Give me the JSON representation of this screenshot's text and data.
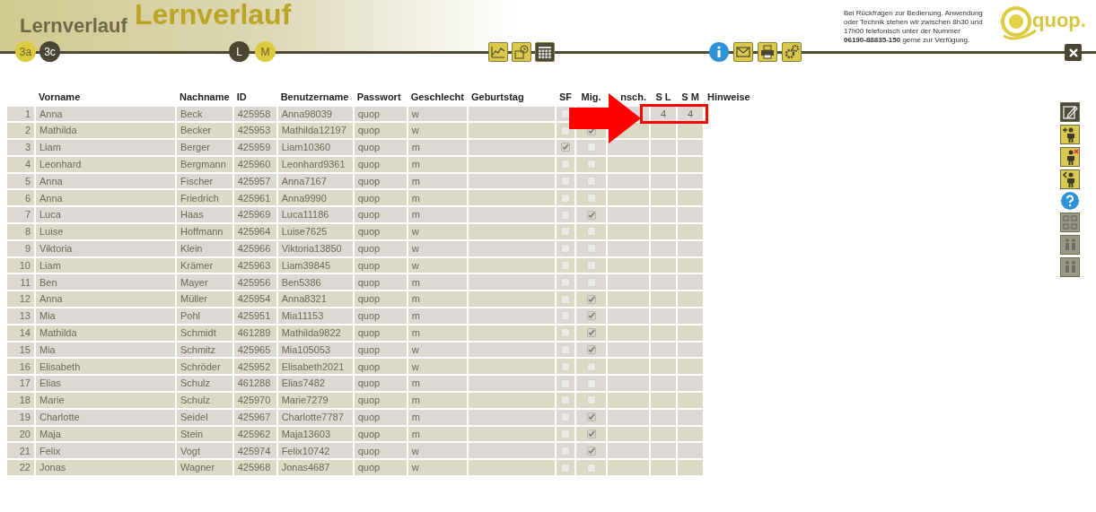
{
  "header": {
    "background_title": "Lernverlauf",
    "title": "Lernverlauf",
    "classes": [
      {
        "label": "3a",
        "selected": false
      },
      {
        "label": "3c",
        "selected": true
      }
    ],
    "subjects": [
      {
        "label": "L",
        "selected": true
      },
      {
        "label": "M",
        "selected": false
      }
    ],
    "contact": {
      "text": "Bei Rückfragen zur Bedienung, Anwendung oder Technik stehen wir zwischen 8h30 und 17h00 telefonisch unter der Nummer **06190-88835-150** gerne zur Verfügung."
    },
    "logo": "quop."
  },
  "table": {
    "columns": [
      "Vorname",
      "Nachname",
      "ID",
      "Benutzername",
      "Passwort",
      "Geschlecht",
      "Geburtstag",
      "SF",
      "Mig.",
      "nsch.",
      "S L",
      "S M",
      "Hinweise"
    ],
    "rows": [
      {
        "no": "1",
        "vorname": "Anna",
        "nachname": "Beck",
        "id": "425958",
        "benutzername": "Anna98039",
        "passwort": "quop",
        "geschlecht": "w",
        "sf": false,
        "sl": "4",
        "sm": "4"
      },
      {
        "no": "2",
        "vorname": "Mathilda",
        "nachname": "Becker",
        "id": "425953",
        "benutzername": "Mathilda12197",
        "passwort": "quop",
        "geschlecht": "w",
        "sf": false,
        "mig": true
      },
      {
        "no": "3",
        "vorname": "Liam",
        "nachname": "Berger",
        "id": "425959",
        "benutzername": "Liam10360",
        "passwort": "quop",
        "geschlecht": "m",
        "sf": true,
        "mig": false
      },
      {
        "no": "4",
        "vorname": "Leonhard",
        "nachname": "Bergmann",
        "id": "425960",
        "benutzername": "Leonhard9361",
        "passwort": "quop",
        "geschlecht": "m",
        "sf": false,
        "mig": false
      },
      {
        "no": "5",
        "vorname": "Anna",
        "nachname": "Fischer",
        "id": "425957",
        "benutzername": "Anna7167",
        "passwort": "quop",
        "geschlecht": "m",
        "sf": false,
        "mig": false
      },
      {
        "no": "6",
        "vorname": "Anna",
        "nachname": "Friedrich",
        "id": "425961",
        "benutzername": "Anna9990",
        "passwort": "quop",
        "geschlecht": "m",
        "sf": false,
        "mig": false
      },
      {
        "no": "7",
        "vorname": "Luca",
        "nachname": "Haas",
        "id": "425969",
        "benutzername": "Luca11186",
        "passwort": "quop",
        "geschlecht": "m",
        "sf": false,
        "mig": true
      },
      {
        "no": "8",
        "vorname": "Luise",
        "nachname": "Hoffmann",
        "id": "425964",
        "benutzername": "Luise7625",
        "passwort": "quop",
        "geschlecht": "w",
        "sf": false,
        "mig": false
      },
      {
        "no": "9",
        "vorname": "Viktoria",
        "nachname": "Klein",
        "id": "425966",
        "benutzername": "Viktoria13850",
        "passwort": "quop",
        "geschlecht": "w",
        "sf": false,
        "mig": false
      },
      {
        "no": "10",
        "vorname": "Liam",
        "nachname": "Krämer",
        "id": "425963",
        "benutzername": "Liam39845",
        "passwort": "quop",
        "geschlecht": "w",
        "sf": false,
        "mig": false
      },
      {
        "no": "11",
        "vorname": "Ben",
        "nachname": "Mayer",
        "id": "425956",
        "benutzername": "Ben5386",
        "passwort": "quop",
        "geschlecht": "m",
        "sf": false,
        "mig": false
      },
      {
        "no": "12",
        "vorname": "Anna",
        "nachname": "Müller",
        "id": "425954",
        "benutzername": "Anna8321",
        "passwort": "quop",
        "geschlecht": "m",
        "sf": false,
        "mig": true
      },
      {
        "no": "13",
        "vorname": "Mia",
        "nachname": "Pohl",
        "id": "425951",
        "benutzername": "Mia11153",
        "passwort": "quop",
        "geschlecht": "m",
        "sf": false,
        "mig": true
      },
      {
        "no": "14",
        "vorname": "Mathilda",
        "nachname": "Schmidt",
        "id": "461289",
        "benutzername": "Mathilda9822",
        "passwort": "quop",
        "geschlecht": "m",
        "sf": false,
        "mig": true
      },
      {
        "no": "15",
        "vorname": "Mia",
        "nachname": "Schmitz",
        "id": "425965",
        "benutzername": "Mia105053",
        "passwort": "quop",
        "geschlecht": "w",
        "sf": false,
        "mig": true
      },
      {
        "no": "16",
        "vorname": "Elisabeth",
        "nachname": "Schröder",
        "id": "425952",
        "benutzername": "Elisabeth2021",
        "passwort": "quop",
        "geschlecht": "w",
        "sf": false,
        "mig": false
      },
      {
        "no": "17",
        "vorname": "Elias",
        "nachname": "Schulz",
        "id": "461288",
        "benutzername": "Elias7482",
        "passwort": "quop",
        "geschlecht": "m",
        "sf": false,
        "mig": false
      },
      {
        "no": "18",
        "vorname": "Marie",
        "nachname": "Schulz",
        "id": "425970",
        "benutzername": "Marie7279",
        "passwort": "quop",
        "geschlecht": "m",
        "sf": false,
        "mig": false
      },
      {
        "no": "19",
        "vorname": "Charlotte",
        "nachname": "Seidel",
        "id": "425967",
        "benutzername": "Charlotte7787",
        "passwort": "quop",
        "geschlecht": "m",
        "sf": false,
        "mig": true
      },
      {
        "no": "20",
        "vorname": "Maja",
        "nachname": "Stein",
        "id": "425962",
        "benutzername": "Maja13603",
        "passwort": "quop",
        "geschlecht": "m",
        "sf": false,
        "mig": true
      },
      {
        "no": "21",
        "vorname": "Felix",
        "nachname": "Vogt",
        "id": "425974",
        "benutzername": "Felix10742",
        "passwort": "quop",
        "geschlecht": "w",
        "sf": false,
        "mig": true
      },
      {
        "no": "22",
        "vorname": "Jonas",
        "nachname": "Wagner",
        "id": "425968",
        "benutzername": "Jonas4687",
        "passwort": "quop",
        "geschlecht": "w",
        "sf": false,
        "mig": false
      }
    ]
  },
  "side_tools": [
    {
      "kind": "edit",
      "disabled": false
    },
    {
      "kind": "add",
      "disabled": false
    },
    {
      "kind": "remove",
      "disabled": false
    },
    {
      "kind": "back",
      "disabled": false
    },
    {
      "kind": "help",
      "disabled": false
    },
    {
      "kind": "grid",
      "disabled": true
    },
    {
      "kind": "group",
      "disabled": true
    },
    {
      "kind": "group",
      "disabled": true
    }
  ]
}
